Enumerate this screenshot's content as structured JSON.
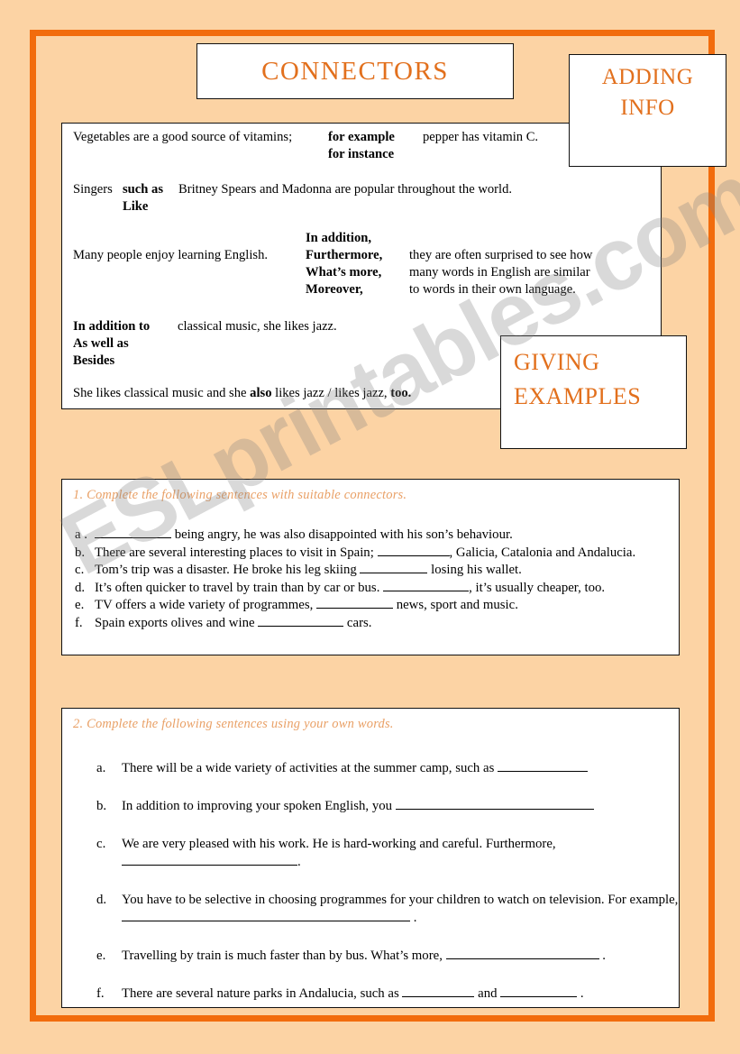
{
  "page": {
    "background_color": "#fcd3a4",
    "frame_color": "#f26c0d",
    "accent_color": "#e2701d",
    "heading_color": "#e9a066",
    "watermark": "ESLprintables.com"
  },
  "title": {
    "text": "CONNECTORS"
  },
  "labels": {
    "adding_info": "ADDING\nINFO",
    "adding_info_line1": "ADDING",
    "adding_info_line2": "INFO",
    "giving_examples_line1": "GIVING",
    "giving_examples_line2": "EXAMPLES"
  },
  "examples": {
    "group1": {
      "left": "Vegetables are a good source of vitamins;",
      "connectors": [
        "for example",
        "for instance"
      ],
      "right": "pepper has vitamin C."
    },
    "group2": {
      "left": "Singers",
      "connectors": [
        "such as",
        "Like"
      ],
      "right": "Britney Spears and Madonna are popular throughout the world."
    },
    "group3": {
      "left": "Many people enjoy learning English.",
      "connectors": [
        "In addition,",
        "Furthermore,",
        "What’s more,",
        "Moreover,"
      ],
      "right_lines": [
        "they are often surprised to see how",
        "many words in English are similar",
        "to words in their own language."
      ]
    },
    "group4": {
      "connectors": [
        "In addition to",
        "As well as",
        "Besides"
      ],
      "right": "classical music, she likes jazz."
    },
    "group5": {
      "pre": "She likes classical music and she ",
      "bold1": "also",
      "mid": " likes jazz / likes jazz, ",
      "bold2": "too."
    }
  },
  "exercise1": {
    "heading": "1. Complete the following sentences with suitable connectors.",
    "items": [
      {
        "label": "a .",
        "pre": "",
        "post": " being angry, he was also disappointed with his son’s behaviour."
      },
      {
        "label": "b.",
        "pre": "There are several interesting places to visit in Spain; ",
        "post": ", Galicia, Catalonia and Andalucia."
      },
      {
        "label": "c.",
        "pre": "Tom’s trip was a disaster. He broke his leg skiing ",
        "post": " losing his wallet."
      },
      {
        "label": "d.",
        "pre": "It’s often quicker to travel by train than by car or bus. ",
        "post": ", it’s usually cheaper, too."
      },
      {
        "label": "e.",
        "pre": "TV offers a wide variety of programmes, ",
        "post": " news, sport and music."
      },
      {
        "label": "f.",
        "pre": "Spain exports olives and wine ",
        "post": " cars."
      }
    ]
  },
  "exercise2": {
    "heading": "2. Complete the following sentences using your own words.",
    "items": [
      {
        "label": "a.",
        "pre": "There will be a wide variety of activities at the summer camp, such as ",
        "post": ""
      },
      {
        "label": "b.",
        "pre": "In addition to improving your spoken English, you ",
        "post": ""
      },
      {
        "label": "c.",
        "pre": "We are very pleased with his work. He is hard-working and careful. Furthermore,",
        "post": "."
      },
      {
        "label": "d.",
        "pre": "You have to be selective in choosing programmes for your children to watch on television. For example, ",
        "post": " ."
      },
      {
        "label": "e.",
        "pre": "Travelling by train is much faster than by bus. What’s more, ",
        "post": " ."
      },
      {
        "label": "f.",
        "pre": "There are several nature parks in Andalucia, such as ",
        "mid": " and ",
        "post": " ."
      }
    ]
  }
}
